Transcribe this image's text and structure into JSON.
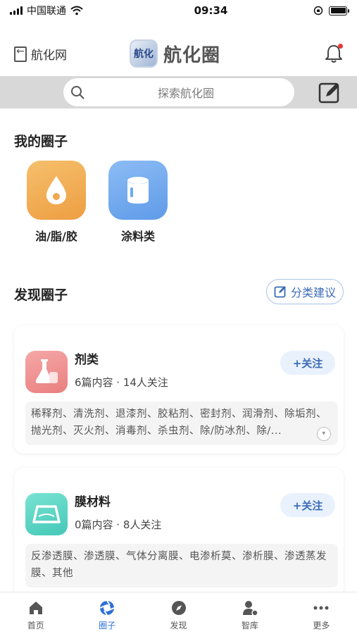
{
  "status_bar": {
    "carrier": "中国联通",
    "time": "09:34"
  },
  "nav": {
    "back_label": "航化网",
    "logo_text": "航化圈",
    "logo_badge": "航化"
  },
  "search": {
    "placeholder": "探索航化圈"
  },
  "my_circles": {
    "title": "我的圈子",
    "items": [
      {
        "label": "油/脂/胶",
        "icon": "oil-drop-icon",
        "color": "#f0a74f"
      },
      {
        "label": "涂料类",
        "icon": "paint-bucket-icon",
        "color": "#6ea8ef"
      }
    ]
  },
  "discover": {
    "title": "发现圈子",
    "suggest_label": "分类建议",
    "cards": [
      {
        "title": "剂类",
        "meta": "6篇内容 · 14人关注",
        "follow_label": "+关注",
        "tags": "稀释剂、清洗剂、退漆剂、胶粘剂、密封剂、润滑剂、除垢剂、抛光剂、灭火剂、消毒剂、杀虫剂、除/防冰剂、除/...",
        "icon": "flask-icon",
        "color": "#ef8e8e"
      },
      {
        "title": "膜材料",
        "meta": "0篇内容 · 8人关注",
        "follow_label": "+关注",
        "tags": "反渗透膜、渗透膜、气体分离膜、电渗析莫、渗析膜、渗透蒸发膜、其他",
        "icon": "membrane-icon",
        "color": "#5fd6c4"
      }
    ]
  },
  "tabbar": {
    "items": [
      {
        "label": "首页",
        "icon": "home-icon"
      },
      {
        "label": "圈子",
        "icon": "circle-icon",
        "active": true
      },
      {
        "label": "发现",
        "icon": "compass-icon"
      },
      {
        "label": "智库",
        "icon": "think-tank-icon"
      },
      {
        "label": "更多",
        "icon": "more-icon"
      }
    ]
  },
  "colors": {
    "accent": "#2f6fd6",
    "follow_bg": "#e9f1fc",
    "search_strip": "#d8d8d8"
  }
}
